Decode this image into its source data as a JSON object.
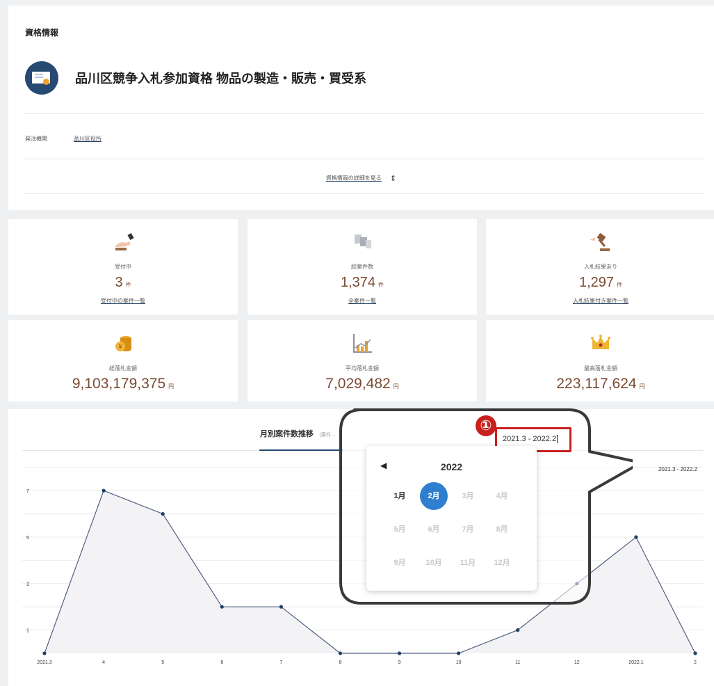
{
  "info": {
    "section_title": "資格情報",
    "qualification_name": "品川区競争入札参加資格 物品の製造・販売・買受系",
    "orderer_label": "発注機関",
    "orderer_value": "品川区役所",
    "details_link": "資格情報の詳細を見る",
    "toggle_icon": "expand-collapse-icon"
  },
  "stats": [
    {
      "label": "受付中",
      "value": "3",
      "unit": "件",
      "link": "受付中の案件一覧",
      "icon": "gavel-hand-icon"
    },
    {
      "label": "総案件数",
      "value": "1,374",
      "unit": "件",
      "link": "全案件一覧",
      "icon": "documents-icon"
    },
    {
      "label": "入札結果あり",
      "value": "1,297",
      "unit": "件",
      "link": "入札結果付き案件一覧",
      "icon": "auction-hammer-icon"
    },
    {
      "label": "総落札金額",
      "value": "9,103,179,375",
      "unit": "円",
      "icon": "coins-icon"
    },
    {
      "label": "平均落札金額",
      "value": "7,029,482",
      "unit": "円",
      "icon": "bar-chart-icon"
    },
    {
      "label": "最高落札金額",
      "value": "223,117,624",
      "unit": "円",
      "icon": "crown-icon"
    }
  ],
  "chart_section": {
    "tab_title": "月別案件数推移",
    "tab_subtitle": "（案件…",
    "range_label_right": "2021.3 - 2022.2"
  },
  "chart_data": {
    "type": "area",
    "categories": [
      "2021.3",
      "4",
      "5",
      "6",
      "7",
      "8",
      "9",
      "10",
      "11",
      "12",
      "2022.1",
      "2"
    ],
    "series": [
      {
        "values": [
          0,
          7,
          6,
          2,
          2,
          0,
          0,
          0,
          1,
          3,
          5,
          0
        ]
      }
    ],
    "yticks": [
      1,
      3,
      5,
      7
    ],
    "ylim": [
      0,
      8
    ],
    "grid": true,
    "line_color": "#4f5f80",
    "fill_color": "#f3f3f5"
  },
  "callout": {
    "badge": "①",
    "range_input_value": "2021.3 -  2022.2",
    "accent_color": "#c8201f"
  },
  "month_picker": {
    "prev_icon": "◀",
    "year": "2022",
    "months": [
      "1月",
      "2月",
      "3月",
      "4月",
      "5月",
      "6月",
      "7月",
      "8月",
      "9月",
      "10月",
      "11月",
      "12月"
    ],
    "enabled": [
      true,
      true,
      false,
      false,
      false,
      false,
      false,
      false,
      false,
      false,
      false,
      false
    ],
    "selected_index": 1,
    "selected_color": "#2f7fd0"
  }
}
